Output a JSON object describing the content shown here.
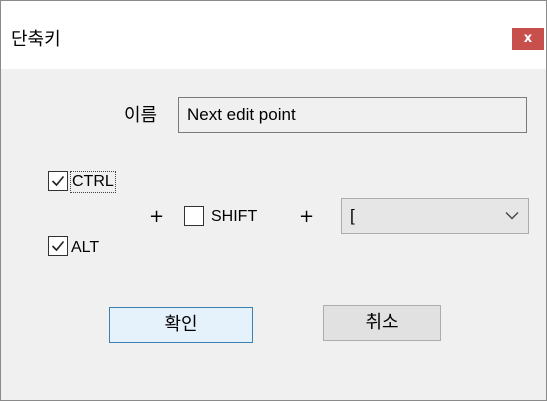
{
  "window": {
    "title": "단축키",
    "close_label": "x"
  },
  "name_field": {
    "label": "이름",
    "value": "Next edit point"
  },
  "modifiers": {
    "ctrl": {
      "label": "CTRL",
      "checked": true
    },
    "alt": {
      "label": "ALT",
      "checked": true
    },
    "shift": {
      "label": "SHIFT",
      "checked": false
    }
  },
  "plus_sign": "+",
  "key_select": {
    "value": "["
  },
  "buttons": {
    "ok_label": "확인",
    "cancel_label": "취소"
  },
  "colors": {
    "close_button": "#c7504c",
    "ok_button_border": "#3c7fb1",
    "ok_button_bg": "#e5f1fb"
  }
}
